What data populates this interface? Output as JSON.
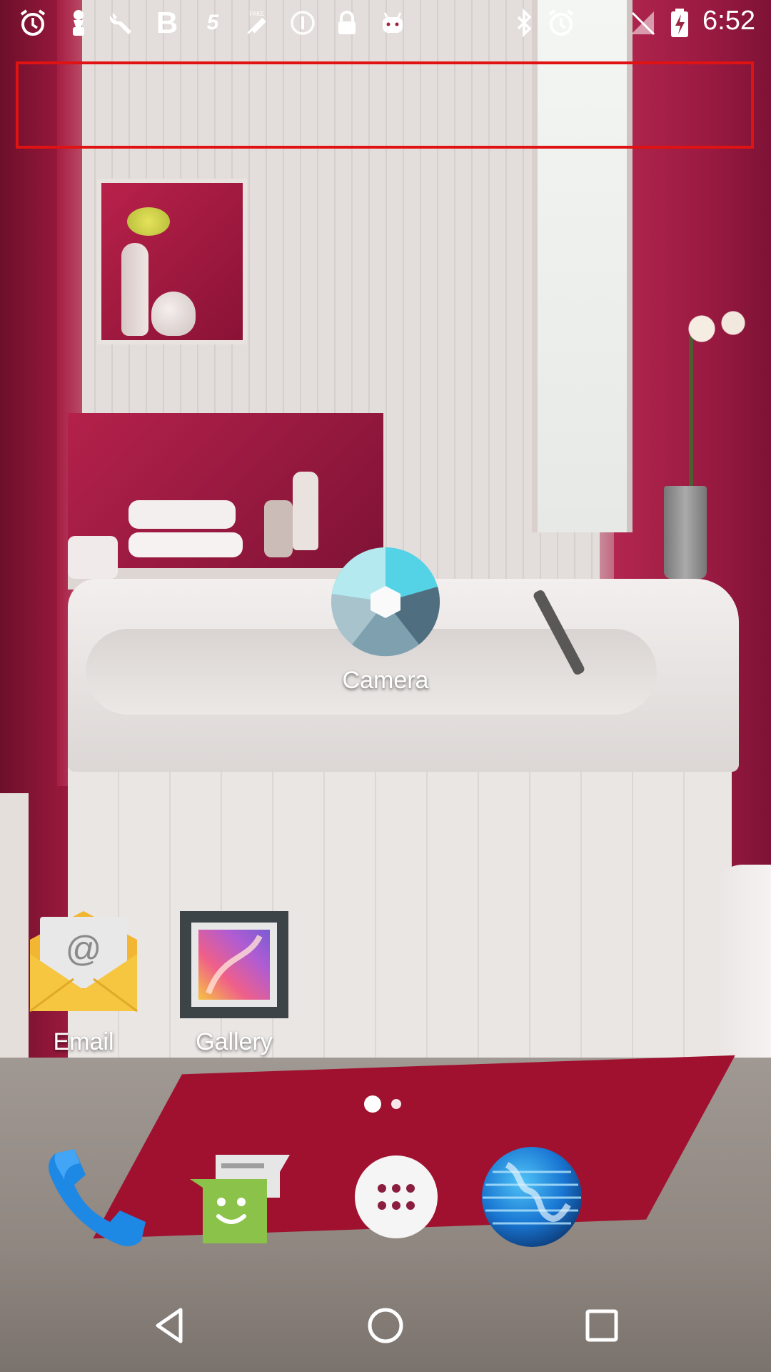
{
  "status_bar": {
    "time": "6:52",
    "left_icons": [
      "alarm-icon",
      "pin-icon",
      "wrench-icon",
      "bold-b-icon",
      "number-5-icon",
      "fake-gps-icon",
      "info-circle-icon",
      "lock-icon",
      "android-icon"
    ],
    "right_icons": [
      "bluetooth-icon",
      "alarm-icon",
      "no-signal-icon",
      "battery-charging-icon"
    ],
    "b_glyph": "B",
    "five_glyph": "5",
    "fake_text": "FAKE"
  },
  "home": {
    "apps": [
      {
        "label": "Camera"
      },
      {
        "label": "Email"
      },
      {
        "label": "Gallery"
      }
    ],
    "page_indicator": {
      "pages": 2,
      "current": 1
    }
  },
  "dock": [
    "Phone",
    "Messaging",
    "All apps",
    "Browser"
  ],
  "nav": [
    "back",
    "home",
    "recents"
  ],
  "colors": {
    "highlight": "#e11212",
    "camera_teal": "#5bd6e6",
    "email_yellow": "#f6c640",
    "messaging_green": "#8bc34a",
    "phone_blue": "#1e88e5"
  }
}
